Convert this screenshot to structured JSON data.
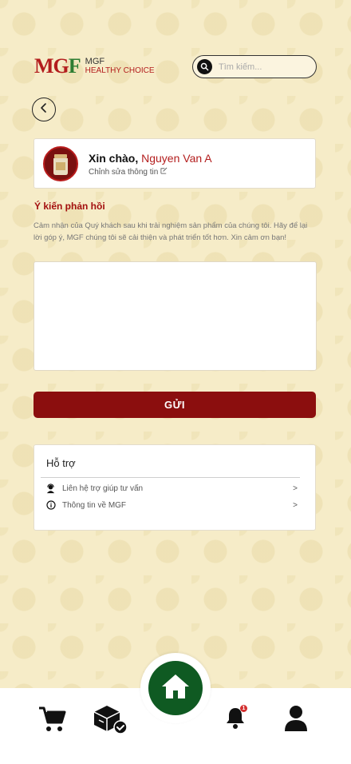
{
  "header": {
    "logo_mark": "MG",
    "logo_mark_f": "F",
    "logo_line1": "MGF",
    "logo_line2": "HEALTHY CHOICE",
    "search_placeholder": "Tìm kiếm..."
  },
  "profile": {
    "greeting": "Xin chào,",
    "name": "Nguyen Van A",
    "edit_label": "Chỉnh sửa thông tin"
  },
  "feedback": {
    "title": "Ý kiến phản hồi",
    "description": "Cảm nhận của Quý khách sau khi trải nghiệm sản phẩm của chúng tôi. Hãy để lại lời góp ý, MGF chúng tôi sẽ cải thiện và phát triển tốt hơn. Xin cảm ơn bạn!",
    "value": "",
    "submit_label": "GỬI"
  },
  "support": {
    "title": "Hỗ trợ",
    "items": [
      {
        "label": "Liên hệ trợ giúp tư vấn",
        "icon": "support-agent-icon"
      },
      {
        "label": "Thông tin về MGF",
        "icon": "info-icon"
      }
    ],
    "chevron": ">"
  },
  "bottom_nav": {
    "items": [
      "cart-icon",
      "delivery-box-icon",
      "home-icon",
      "bell-icon",
      "user-icon"
    ],
    "notification_count": "1"
  },
  "colors": {
    "brand_red": "#8b0e0e",
    "home_green": "#0f5a22",
    "background": "#f6ecc8"
  }
}
